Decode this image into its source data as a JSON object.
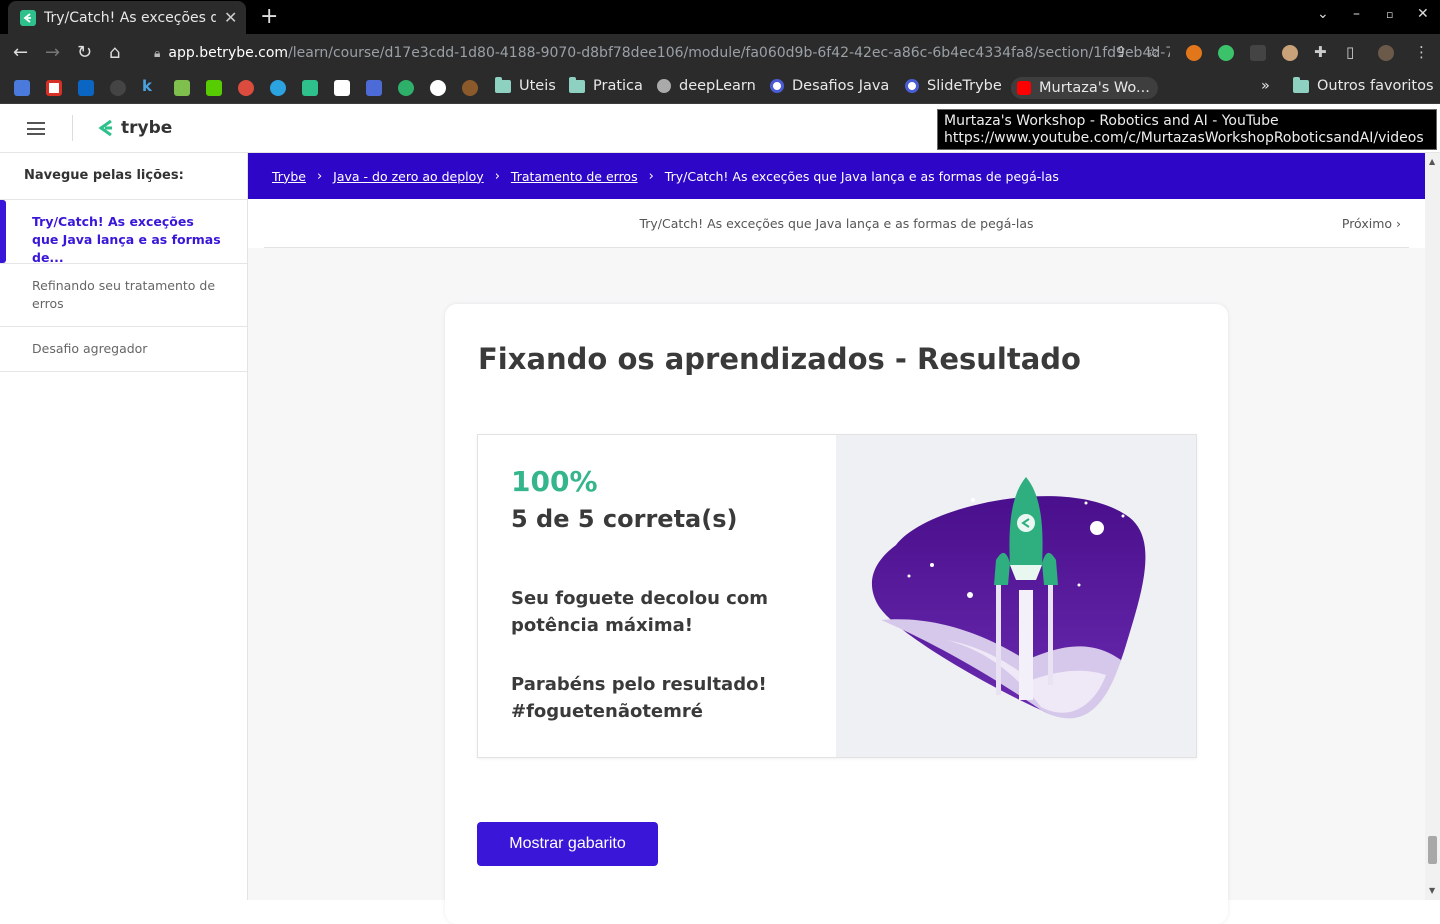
{
  "browser": {
    "tab_title": "Try/Catch! As exceções qu",
    "url_host": "app.betrybe.com",
    "url_path": "/learn/course/d17e3cdd-1d80-4188-9070-d8bf78dee106/module/fa060d9b-6f42-42ec-a86c-6b4ec4334fa8/section/1fd9eb4d-71...",
    "bookmarks": [
      {
        "label": "Uteis",
        "type": "folder"
      },
      {
        "label": "Pratica",
        "type": "folder"
      },
      {
        "label": "deepLearn",
        "type": "site"
      },
      {
        "label": "Desafios Java",
        "type": "site"
      },
      {
        "label": "SlideTrybe",
        "type": "site"
      },
      {
        "label": "Murtaza's Wo...",
        "type": "youtube"
      }
    ],
    "bookmarks_more": "»",
    "other_bookmarks": "Outros favoritos",
    "tooltip_line1": "Murtaza's Workshop - Robotics and AI - YouTube",
    "tooltip_line2": "https://www.youtube.com/c/MurtazasWorkshopRoboticsandAI/videos"
  },
  "header": {
    "logo_text": "trybe"
  },
  "sidebar": {
    "heading": "Navegue pelas lições:",
    "items": [
      {
        "label": "Try/Catch! As exceções que Java lança e as formas de...",
        "active": true
      },
      {
        "label": "Refinando seu tratamento de erros",
        "active": false
      },
      {
        "label": "Desafio agregador",
        "active": false
      }
    ]
  },
  "breadcrumb": {
    "items": [
      "Trybe",
      "Java - do zero ao deploy",
      "Tratamento de erros"
    ],
    "current": "Try/Catch! As exceções que Java lança e as formas de pegá-las"
  },
  "lesson": {
    "title": "Try/Catch! As exceções que Java lança e as formas de pegá-las",
    "next_label": "Próximo"
  },
  "result": {
    "card_title": "Fixando os aprendizados - Resultado",
    "percent": "100%",
    "score": "5 de 5 correta(s)",
    "message1_line1": "Seu foguete decolou com",
    "message1_line2": "potência máxima!",
    "message2_line1": "Parabéns pelo resultado!",
    "message2_line2": "#foguetenãotemré",
    "button_label": "Mostrar gabarito"
  },
  "colors": {
    "brand_purple": "#3a16d8",
    "breadcrumb_bg": "#2d06c8",
    "accent_green": "#35b58b"
  }
}
